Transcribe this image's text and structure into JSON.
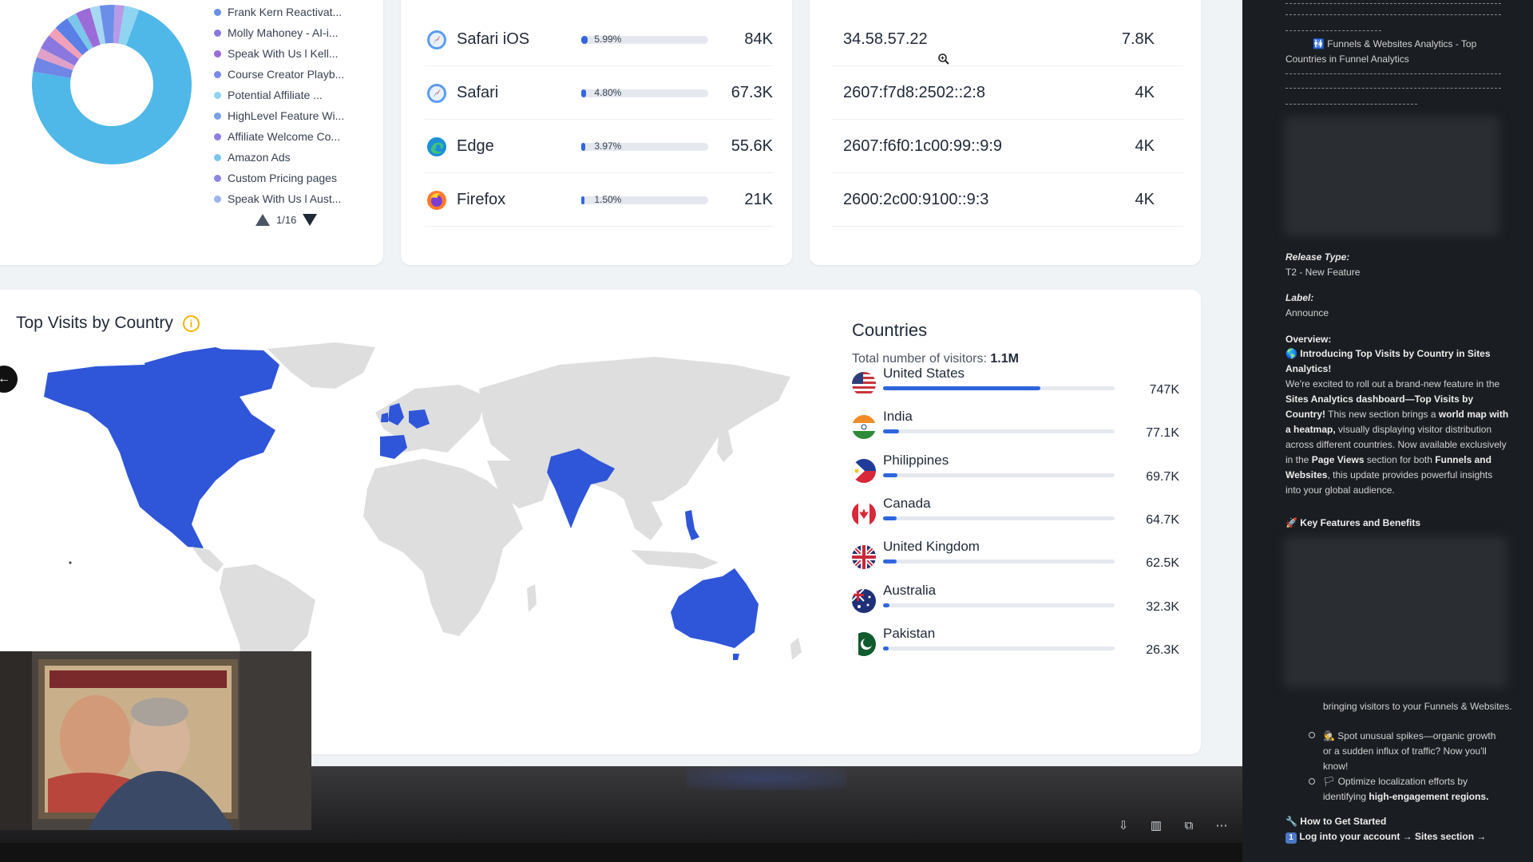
{
  "pages_card": {
    "legend": [
      {
        "label": "Frank Kern Reactivat...",
        "color": "#6b8fe8"
      },
      {
        "label": "Molly Mahoney - AI-i...",
        "color": "#8a78e0"
      },
      {
        "label": "Speak With Us l Kell...",
        "color": "#9b6bd8"
      },
      {
        "label": "Course Creator Playb...",
        "color": "#7a8be8"
      },
      {
        "label": "Potential Affiliate ...",
        "color": "#8fd4f0"
      },
      {
        "label": "HighLevel Feature Wi...",
        "color": "#7aa0ec"
      },
      {
        "label": "Affiliate Welcome Co...",
        "color": "#8e7fe0"
      },
      {
        "label": "Amazon Ads",
        "color": "#7cc6ea"
      },
      {
        "label": "Custom Pricing pages",
        "color": "#8b86e4"
      },
      {
        "label": "Speak With Us l Aust...",
        "color": "#9eb4ee"
      }
    ],
    "pager": "1/16",
    "donut_slices": [
      {
        "value": 0.72,
        "color": "#4fb8e8"
      },
      {
        "value": 0.03,
        "color": "#6f86e6"
      },
      {
        "value": 0.02,
        "color": "#e0a0c8"
      },
      {
        "value": 0.03,
        "color": "#8a78e0"
      },
      {
        "value": 0.02,
        "color": "#f2a0b8"
      },
      {
        "value": 0.03,
        "color": "#5a7fe6"
      },
      {
        "value": 0.02,
        "color": "#7cc6ea"
      },
      {
        "value": 0.03,
        "color": "#9b6bd8"
      },
      {
        "value": 0.02,
        "color": "#a7d8f2"
      },
      {
        "value": 0.03,
        "color": "#6b8fe8"
      },
      {
        "value": 0.02,
        "color": "#b79be8"
      },
      {
        "value": 0.03,
        "color": "#8fd4f0"
      }
    ]
  },
  "browsers": [
    {
      "name": "Safari iOS",
      "pct_label": "5.99%",
      "pct": 5.99,
      "value": "84K",
      "icon": "safari-icon"
    },
    {
      "name": "Safari",
      "pct_label": "4.80%",
      "pct": 4.8,
      "value": "67.3K",
      "icon": "safari-icon"
    },
    {
      "name": "Edge",
      "pct_label": "3.97%",
      "pct": 3.97,
      "value": "55.6K",
      "icon": "edge-icon"
    },
    {
      "name": "Firefox",
      "pct_label": "1.50%",
      "pct": 1.5,
      "value": "21K",
      "icon": "firefox-icon"
    }
  ],
  "ips": [
    {
      "ip": "34.58.57.22",
      "value": "7.8K"
    },
    {
      "ip": "2607:f7d8:2502::2:8",
      "value": "4K"
    },
    {
      "ip": "2607:f6f0:1c00:99::9:9",
      "value": "4K"
    },
    {
      "ip": "2600:2c00:9100::9:3",
      "value": "4K"
    }
  ],
  "country_card": {
    "title": "Top Visits by Country",
    "info_icon": "i",
    "countries_title": "Countries",
    "total_label": "Total number of visitors:",
    "total_value": "1.1M",
    "highlight_color": "#2f56d8",
    "land_color": "#dedede",
    "countries": [
      {
        "name": "United States",
        "value": "747K",
        "share": 0.68,
        "flag": "us-flag"
      },
      {
        "name": "India",
        "value": "77.1K",
        "share": 0.07,
        "flag": "india-flag"
      },
      {
        "name": "Philippines",
        "value": "69.7K",
        "share": 0.063,
        "flag": "philippines-flag"
      },
      {
        "name": "Canada",
        "value": "64.7K",
        "share": 0.059,
        "flag": "canada-flag"
      },
      {
        "name": "United Kingdom",
        "value": "62.5K",
        "share": 0.057,
        "flag": "uk-flag"
      },
      {
        "name": "Australia",
        "value": "32.3K",
        "share": 0.029,
        "flag": "australia-flag"
      },
      {
        "name": "Pakistan",
        "value": "26.3K",
        "share": 0.024,
        "flag": "pakistan-flag"
      }
    ]
  },
  "controls": {
    "download_icon": "⇩",
    "layout_icon": "▥",
    "copy_icon": "⧉",
    "more_icon": "⋯"
  },
  "side_panel": {
    "heading_emoji": "🚻",
    "heading": "Funnels & Websites Analytics - Top Countries in Funnel Analytics",
    "release_type_label": "Release Type:",
    "release_type": "T2 - New Feature",
    "label_label": "Label:",
    "label_value": "Announce",
    "overview_label": "Overview:",
    "overview_title": "Introducing Top Visits by Country in Sites Analytics!",
    "overview_p1": "We're excited to roll out a brand-new feature in the",
    "overview_b1": "Sites Analytics dashboard—Top Visits by Country!",
    "overview_p2": "This new section brings a",
    "overview_b2": "world map with a heatmap,",
    "overview_p3": "visually displaying visitor distribution across different countries. Now available exclusively in the",
    "overview_b3": "Page Views",
    "overview_p4": "section for both",
    "overview_b4": "Funnels and Websites",
    "overview_p5": ", this update provides powerful insights into your global audience.",
    "key_features": "Key Features and Benefits",
    "bullet0": "bringing visitors to your Funnels & Websites.",
    "bullet1": "Spot unusual spikes—organic growth or a sudden influx of traffic? Now you'll know!",
    "bullet2a": "Optimize localization efforts by identifying",
    "bullet2b": "high-engagement regions.",
    "how_to": "How to Get Started",
    "step1": "Log into your account → Sites section →"
  }
}
